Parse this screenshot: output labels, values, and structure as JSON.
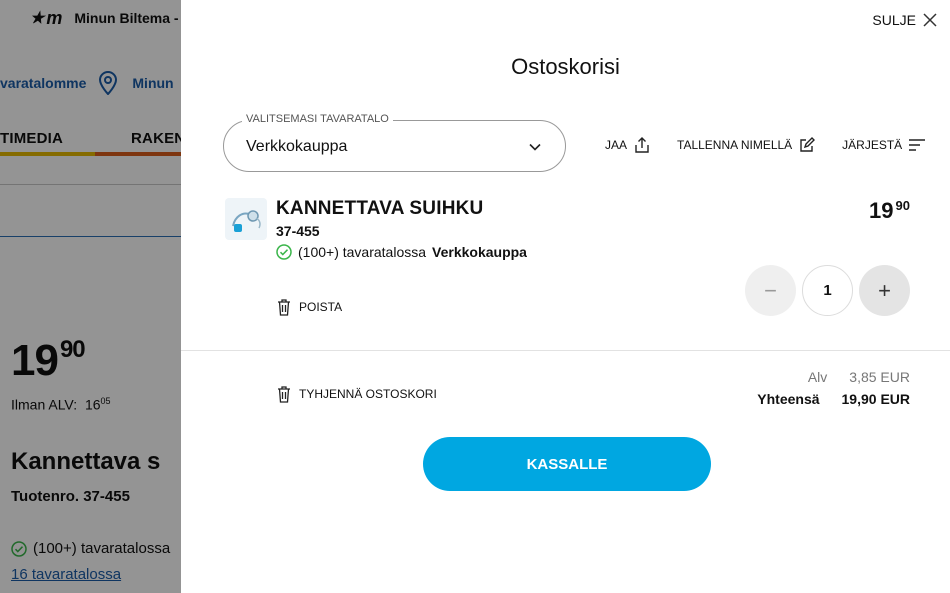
{
  "background": {
    "brand": "Minun Biltema - N",
    "nav1": {
      "stores_link": "varatalomme",
      "my_link": "Minun"
    },
    "nav2": {
      "tab1": "TIMEDIA",
      "tab2": "RAKEN"
    },
    "price_int": "19",
    "price_dec": "90",
    "vat_label": "Ilman ALV:",
    "vat_int": "16",
    "vat_dec": "05",
    "title": "Kannettava s",
    "product_no": "Tuotenro. 37-455",
    "stock": "(100+) tavaratalossa",
    "stores": "16 tavaratalossa"
  },
  "drawer": {
    "close_label": "SULJE",
    "title": "Ostoskorisi",
    "store_select": {
      "label": "VALITSEMASI TAVARATALO",
      "value": "Verkkokauppa"
    },
    "actions": {
      "share": "JAA",
      "save": "TALLENNA NIMELLÄ",
      "sort": "JÄRJESTÄ"
    },
    "item": {
      "name": "KANNETTAVA SUIHKU",
      "number": "37-455",
      "stock_prefix": "(100+) tavaratalossa",
      "stock_store": "Verkkokauppa",
      "price_int": "19",
      "price_dec": "90",
      "remove_label": "POISTA",
      "quantity": "1"
    },
    "clear_label": "TYHJENNÄ OSTOSKORI",
    "totals": {
      "vat_label": "Alv",
      "vat_value": "3,85 EUR",
      "total_label": "Yhteensä",
      "total_value": "19,90 EUR"
    },
    "checkout_label": "KASSALLE"
  },
  "colors": {
    "accent": "#00a7e1",
    "check": "#3ab54a",
    "link": "#1a5ca8"
  }
}
